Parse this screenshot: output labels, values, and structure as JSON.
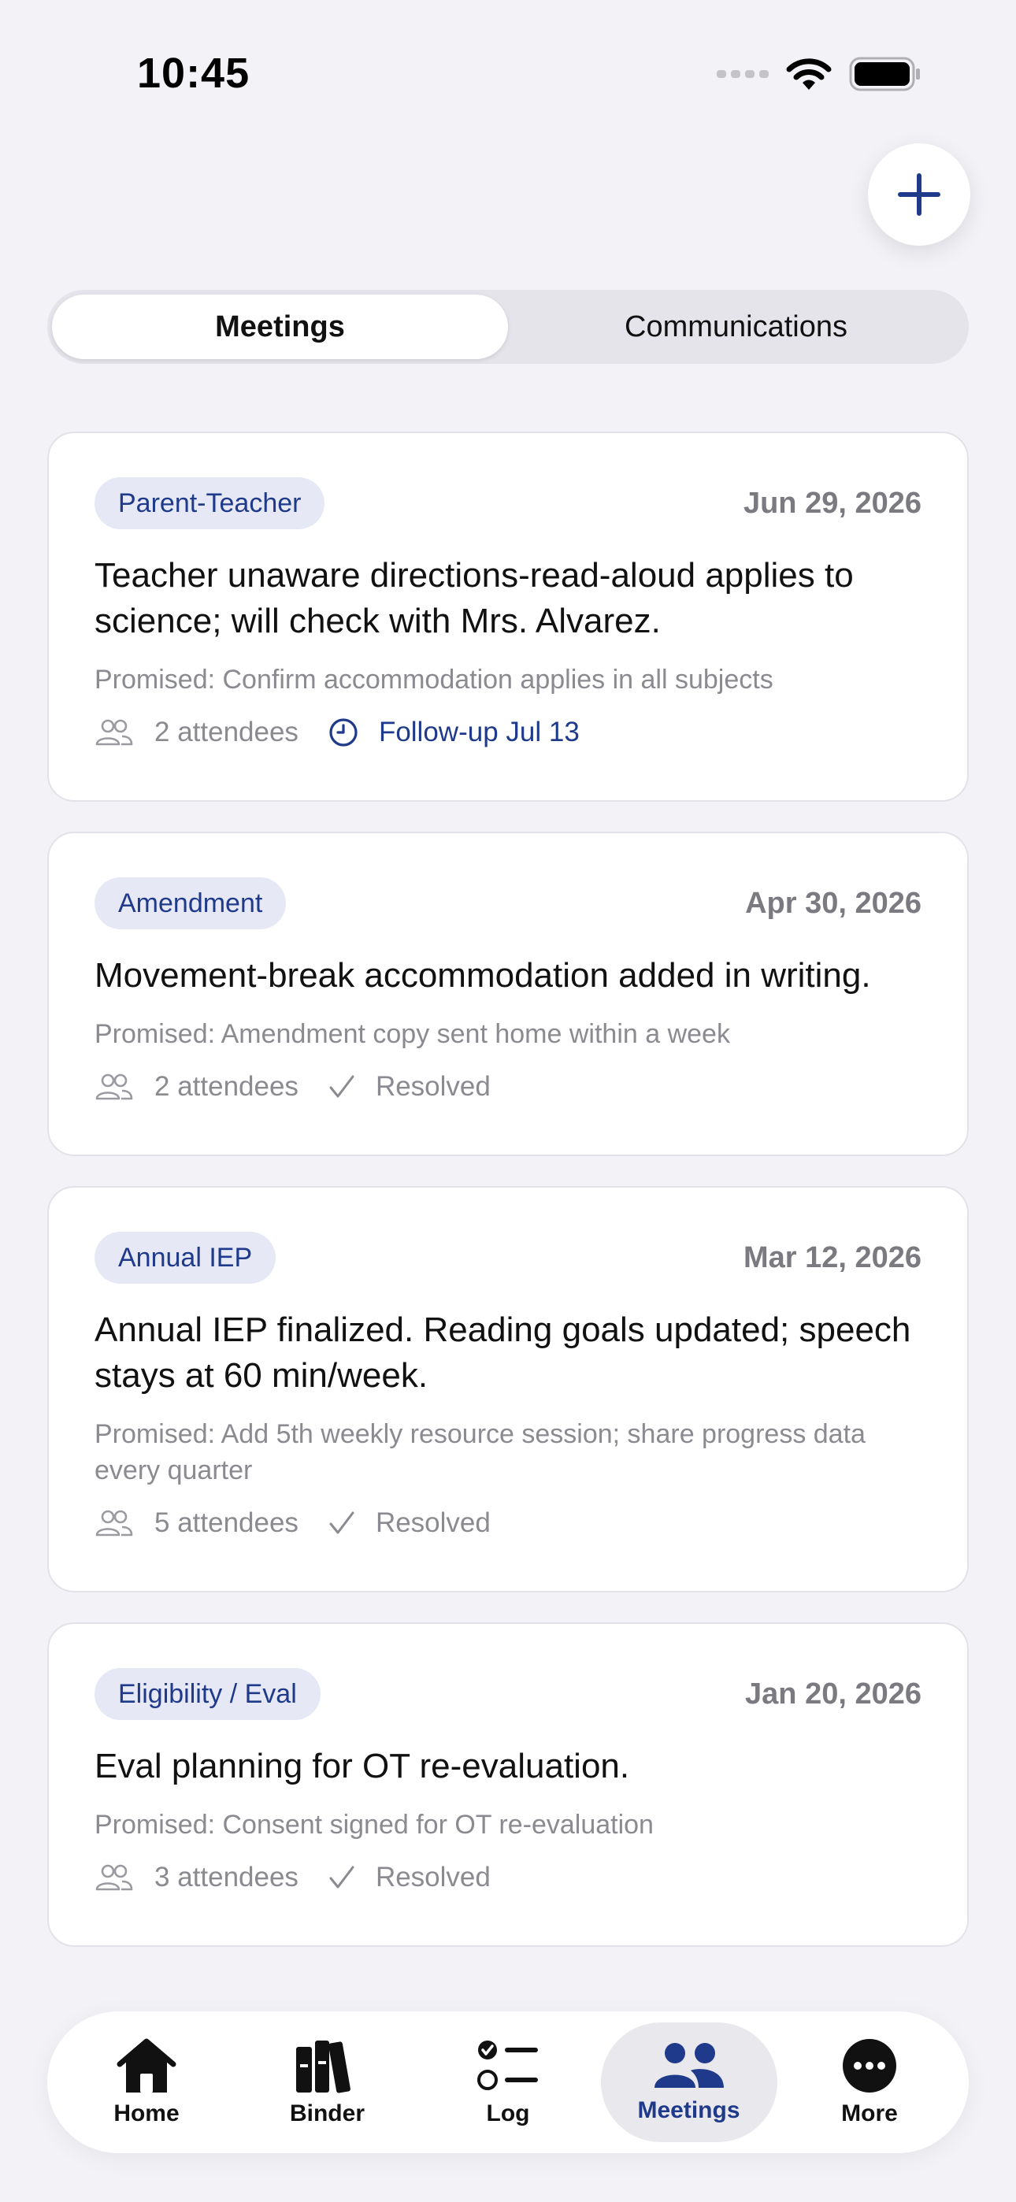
{
  "status_bar": {
    "time": "10:45"
  },
  "segments": [
    {
      "label": "Meetings",
      "active": true
    },
    {
      "label": "Communications",
      "active": false
    }
  ],
  "meetings": [
    {
      "type": "Parent-Teacher",
      "date": "Jun 29, 2026",
      "summary": "Teacher unaware directions-read-aloud applies to science; will check with Mrs. Alvarez.",
      "promised": "Promised: Confirm accommodation applies in all subjects",
      "attendees": "2 attendees",
      "status": "Follow-up Jul 13",
      "status_icon": "clock-icon"
    },
    {
      "type": "Amendment",
      "date": "Apr 30, 2026",
      "summary": "Movement-break accommodation added in writing.",
      "promised": "Promised: Amendment copy sent home within a week",
      "attendees": "2 attendees",
      "status": "Resolved",
      "status_icon": "checkmark-icon"
    },
    {
      "type": "Annual IEP",
      "date": "Mar 12, 2026",
      "summary": "Annual IEP finalized. Reading goals updated; speech stays at 60 min/week.",
      "promised": "Promised: Add 5th weekly resource session; share progress data every quarter",
      "attendees": "5 attendees",
      "status": "Resolved",
      "status_icon": "checkmark-icon"
    },
    {
      "type": "Eligibility / Eval",
      "date": "Jan 20, 2026",
      "summary": "Eval planning for OT re-evaluation.",
      "promised": "Promised: Consent signed for OT re-evaluation",
      "attendees": "3 attendees",
      "status": "Resolved",
      "status_icon": "checkmark-icon"
    }
  ],
  "tab_bar": [
    {
      "label": "Home",
      "icon": "house-icon",
      "active": false
    },
    {
      "label": "Binder",
      "icon": "books-icon",
      "active": false
    },
    {
      "label": "Log",
      "icon": "checklist-icon",
      "active": false
    },
    {
      "label": "Meetings",
      "icon": "people-icon",
      "active": true
    },
    {
      "label": "More",
      "icon": "ellipsis-icon",
      "active": false
    }
  ],
  "colors": {
    "accent": "#1f3a8a",
    "background": "#f2f2f7",
    "muted": "#8a8a90"
  }
}
